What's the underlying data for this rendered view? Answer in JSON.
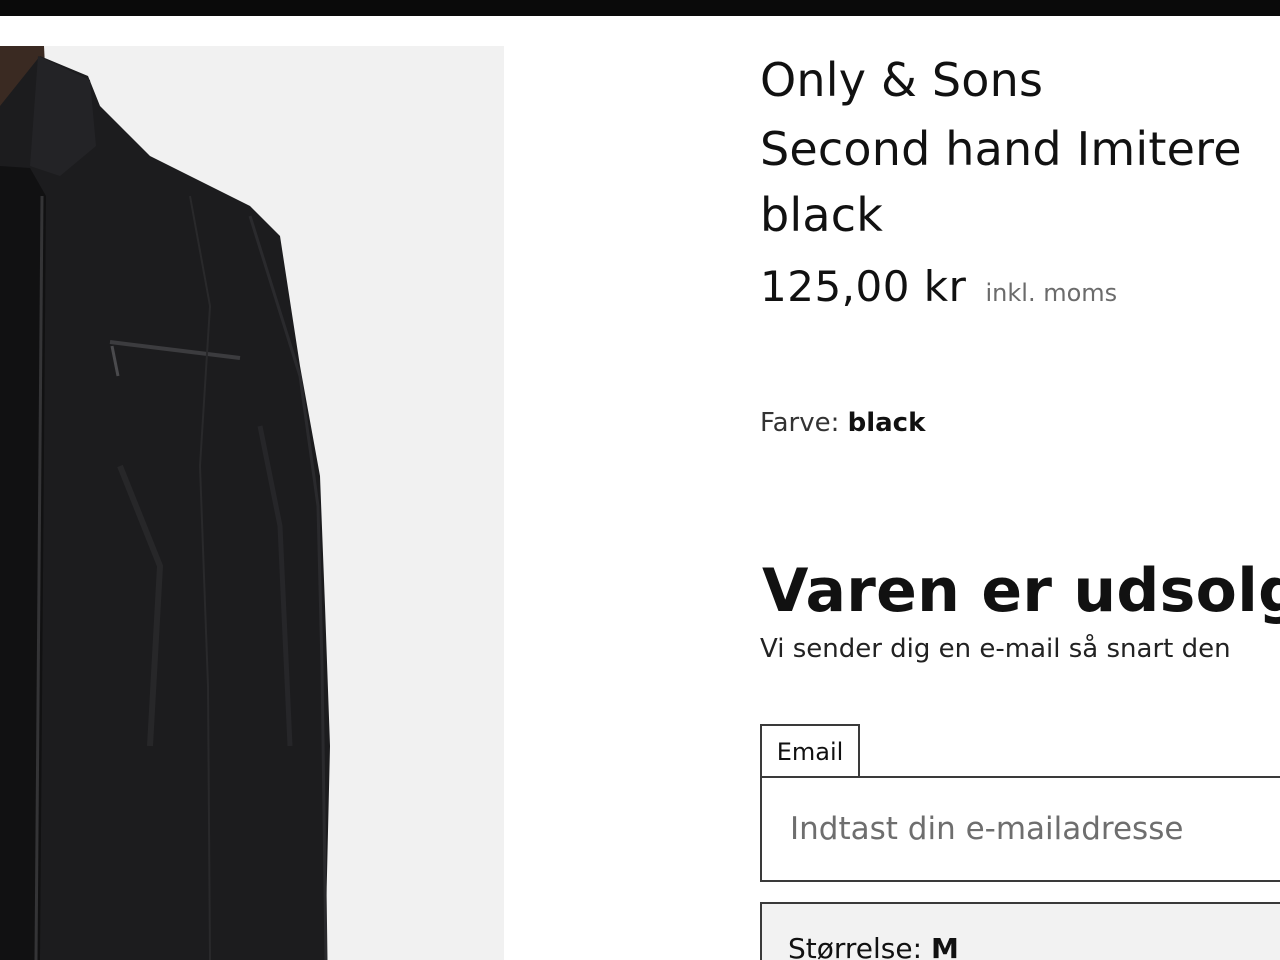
{
  "product": {
    "brand": "Only & Sons",
    "title_line1": "Second hand Imitere",
    "title_line2": "black",
    "price": "125,00 kr",
    "vat_note": "inkl. moms",
    "color_label": "Farve:",
    "color_value": "black"
  },
  "soldout": {
    "heading": "Varen er udsolgt",
    "text": "Vi sender dig en e-mail så snart den"
  },
  "email_form": {
    "label": "Email",
    "placeholder": "Indtast din e-mailadresse"
  },
  "size_select": {
    "label": "Størrelse:",
    "value": "M"
  },
  "colors": {
    "topbar": "#0a0a0a",
    "photo_background": "#f1f1f1",
    "jacket": "#1c1c1e"
  },
  "image": {
    "subject": "black-jacket-photo"
  }
}
